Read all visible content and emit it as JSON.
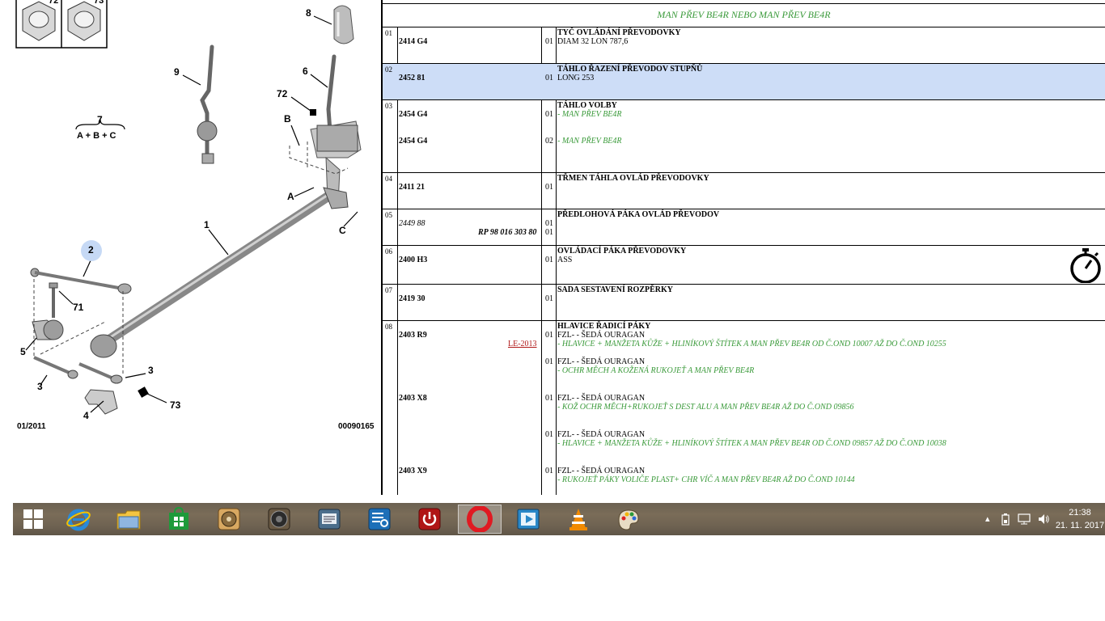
{
  "diagram": {
    "callouts": [
      "72",
      "73",
      "8",
      "9",
      "6",
      "72",
      "7",
      "A + B + C",
      "B",
      "A",
      "C",
      "1",
      "2",
      "71",
      "5",
      "3",
      "3",
      "4",
      "73"
    ],
    "date_code": "01/2011",
    "figure_number": "00090165"
  },
  "parts_table": {
    "header": "MAN PŘEV BE4R NEBO MAN PŘEV BE4R",
    "rows": [
      {
        "num": "01",
        "ref": "2414 G4",
        "qty": "01",
        "title": "TYČ OVLÁDÁNÍ PŘEVODOVKY",
        "line": "DIAM 32 LON 787,6"
      },
      {
        "num": "02",
        "ref": "2452 81",
        "qty": "01",
        "title": "TÁHLO ŘAZENÍ PŘEVODOV STUPŇŮ",
        "line": "LONG 253"
      },
      {
        "num": "03",
        "ref": "2454 G4",
        "qty": "01",
        "title": "TÁHLO VOLBY",
        "green": "- MAN PŘEV BE4R",
        "ref2": "2454 G4",
        "qty2": "02",
        "green2": "- MAN PŘEV BE4R"
      },
      {
        "num": "04",
        "ref": "2411 21",
        "qty": "01",
        "title": "TŘMEN TÁHLA OVLÁD PŘEVODOVKY"
      },
      {
        "num": "05",
        "ref": "2449 88",
        "qty": "01",
        "title": "PŘEDLOHOVÁ PÁKA OVLÁD PŘEVODOV",
        "ref_extra": "RP 98 016 303 80",
        "qty_extra": "01"
      },
      {
        "num": "06",
        "ref": "2400 H3",
        "qty": "01",
        "title": "OVLÁDACÍ PÁKA PŘEVODOVKY",
        "line": "ASS"
      },
      {
        "num": "07",
        "ref": "2419 30",
        "qty": "01",
        "title": "SADA SESTAVENÍ ROZPĚRKY"
      },
      {
        "num": "08",
        "ref": "2403 R9",
        "link": "LE-2013",
        "title": "HLAVICE ŘADICÍ PÁKY",
        "items": [
          {
            "qty": "01",
            "line": "FZL- - ŠEDÁ OURAGAN",
            "green": "- HLAVICE + MANŽETA KŮŽE + HLINÍKOVÝ ŠTÍTEK A MAN PŘEV BE4R OD Č.OND 10007 AŽ DO Č.OND 10255"
          },
          {
            "qty": "01",
            "line": "FZL- - ŠEDÁ OURAGAN",
            "green": "- OCHR MĚCH A KOŽENÁ RUKOJEŤ A MAN PŘEV BE4R"
          },
          {
            "ref": "2403 X8",
            "qty": "01",
            "line": "FZL- - ŠEDÁ OURAGAN",
            "green": "- KOŽ OCHR MĚCH+RUKOJEŤ S DEST ALU A MAN PŘEV BE4R AŽ DO Č.OND 09856"
          },
          {
            "qty": "01",
            "line": "FZL- - ŠEDÁ OURAGAN",
            "green": "- HLAVICE + MANŽETA KŮŽE + HLINÍKOVÝ ŠTÍTEK A MAN PŘEV BE4R OD Č.OND 09857 AŽ DO Č.OND 10038"
          },
          {
            "ref": "2403 X9",
            "qty": "01",
            "line": "FZL- - ŠEDÁ OURAGAN",
            "green": "- RUKOJEŤ PÁKY VOLIČE PLAST+ CHR VÍČ A MAN PŘEV BE4R AŽ DO Č.OND 10144"
          }
        ]
      }
    ]
  },
  "taskbar": {
    "apps": [
      "start-icon",
      "internet-explorer-icon",
      "file-explorer-icon",
      "store-icon",
      "disk-utility-icon",
      "speaker-app-icon",
      "document-app-icon",
      "settings-app-icon",
      "power-app-icon",
      "opera-icon",
      "media-player-icon",
      "vlc-icon",
      "paint-icon"
    ],
    "active_app": "opera-icon",
    "tray": {
      "time": "21:38",
      "date": "21. 11. 2017"
    }
  }
}
